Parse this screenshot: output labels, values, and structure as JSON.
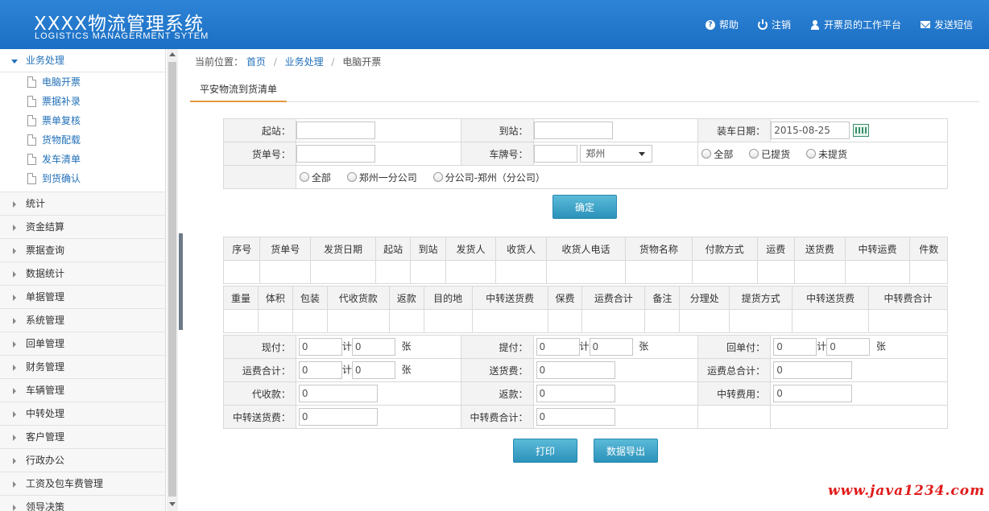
{
  "header": {
    "title_cn": "XXXX物流管理系统",
    "title_en": "LOGISTICS MANAGERMENT SYTEM",
    "nav": [
      "帮助",
      "注销",
      "开票员的工作平台",
      "发送短信"
    ]
  },
  "sidebar": {
    "open_menu": "业务处理",
    "sub_items": [
      "电脑开票",
      "票据补录",
      "票单复核",
      "货物配载",
      "发车清单",
      "到货确认"
    ],
    "menus": [
      "统计",
      "资金结算",
      "票据查询",
      "数据统计",
      "单据管理",
      "系统管理",
      "回单管理",
      "财务管理",
      "车辆管理",
      "中转处理",
      "客户管理",
      "行政办公",
      "工资及包车费管理",
      "领导决策"
    ]
  },
  "breadcrumb": {
    "prefix": "当前位置：",
    "home": "首页",
    "section": "业务处理",
    "current": "电脑开票"
  },
  "tab": "平安物流到货清单",
  "form": {
    "start_label": "起站：",
    "dest_label": "到站：",
    "load_date_label": "装车日期：",
    "load_date_value": "2015-08-25",
    "bill_no_label": "货单号：",
    "plate_label": "车牌号：",
    "plate_select": "郑州",
    "pickup_options": [
      "全部",
      "已提货",
      "未提货"
    ],
    "company_options": [
      "全部",
      "郑州一分公司",
      "分公司-郑州（分公司）"
    ],
    "confirm": "确定"
  },
  "table1_headers": [
    "序号",
    "货单号",
    "发货日期",
    "起站",
    "到站",
    "发货人",
    "收货人",
    "收货人电话",
    "货物名称",
    "付款方式",
    "运费",
    "送货费",
    "中转运费",
    "件数"
  ],
  "table2_headers": [
    "重量",
    "体积",
    "包装",
    "代收货款",
    "返款",
    "目的地",
    "中转送货费",
    "保费",
    "运费合计",
    "备注",
    "分理处",
    "提货方式",
    "中转送货费",
    "中转费合计"
  ],
  "summary": {
    "xianfu": "现付：",
    "tifu": "提付：",
    "huidanfu": "回单付：",
    "ji": "计",
    "zhang": "张",
    "yunfei_heji": "运费合计：",
    "songhuofei": "送货费：",
    "yunfei_zong": "运费总合计：",
    "daishou": "代收款：",
    "fankuan": "返款：",
    "zhongzhuan_fei": "中转费用：",
    "zz_songhuo": "中转送货费：",
    "zz_heji": "中转费合计：",
    "zero": "0"
  },
  "buttons": {
    "print": "打印",
    "export": "数据导出"
  },
  "watermark": "www.java1234.com"
}
